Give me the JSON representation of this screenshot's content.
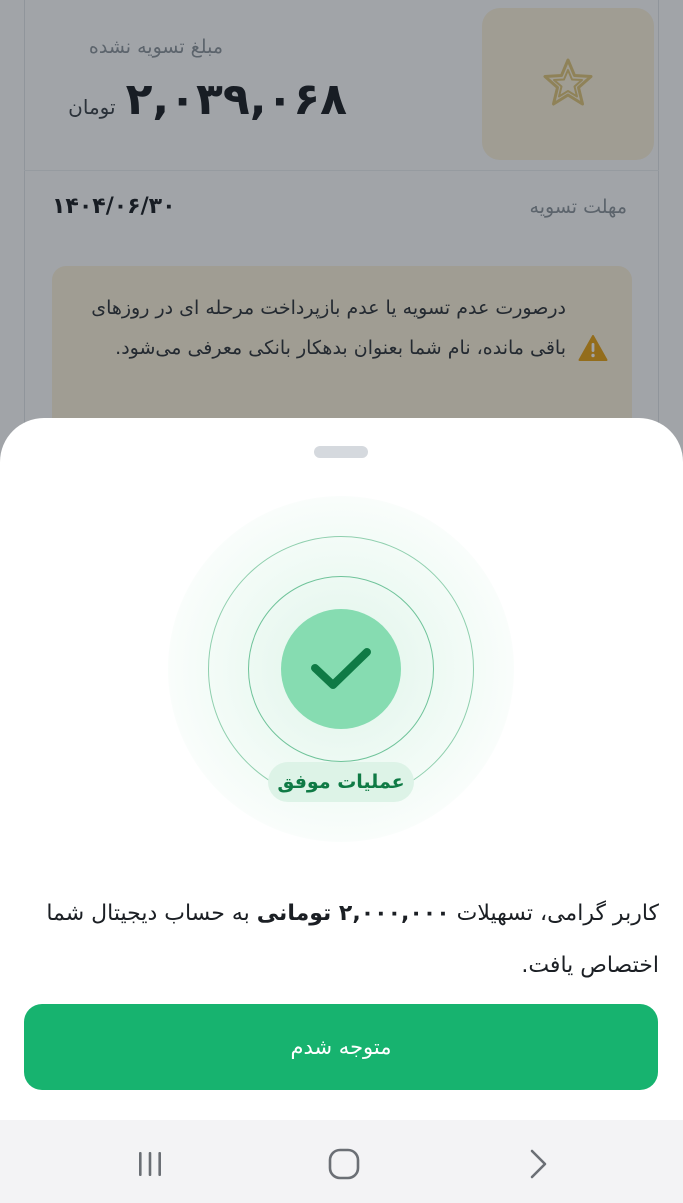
{
  "background": {
    "unpaid_label": "مبلغ تسویه نشده",
    "unpaid_amount": "۲,۰۳۹,۰۶۸",
    "unpaid_unit": "تومان",
    "deadline_label": "مهلت تسویه",
    "deadline_value": "۱۴۰۴/۰۶/۳۰",
    "warning_text": "درصورت عدم تسویه یا عدم بازپرداخت مرحله ای در روزهای باقی مانده، نام شما بعنوان بدهکار بانکی معرفی می‌شود."
  },
  "sheet": {
    "status_badge": "عملیات موفق",
    "message_part1": "کاربر گرامی، تسهیلات ",
    "message_amount": "۲,۰۰۰,۰۰۰ تومانی",
    "message_part2": " به حساب دیجیتال شما اختصاص یافت.",
    "confirm_label": "متوجه شدم"
  },
  "colors": {
    "primary_green": "#17b36f",
    "success_light": "#86dcb1",
    "warning_bg": "#fdf3dc",
    "warning_icon": "#e8a317"
  },
  "icons": {
    "star": "star-icon",
    "warning": "warning-icon",
    "check": "check-icon",
    "recent": "recent-apps-icon",
    "home": "home-icon",
    "back": "back-icon"
  }
}
